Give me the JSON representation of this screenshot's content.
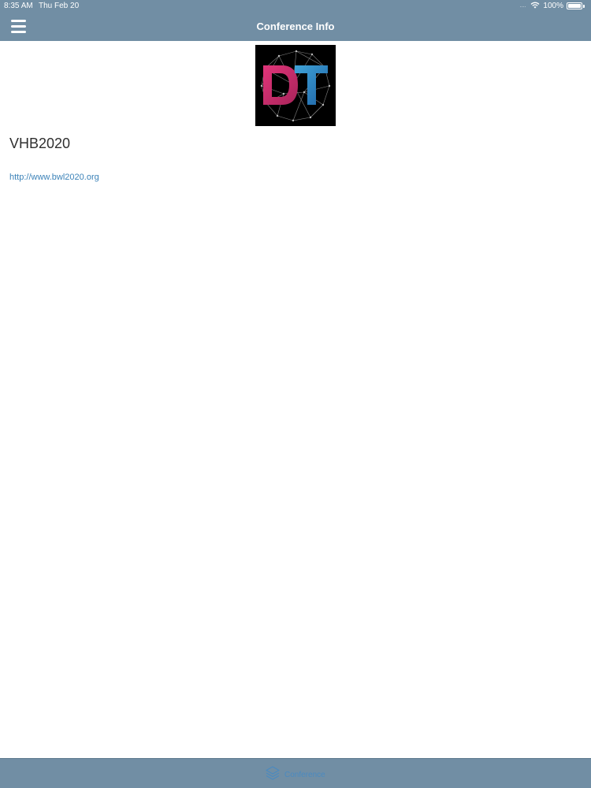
{
  "status_bar": {
    "time": "8:35 AM",
    "date": "Thu Feb 20",
    "signal": "....",
    "wifi_icon": "wifi-icon",
    "battery_text": "100%",
    "battery_level": 1.0
  },
  "nav": {
    "title": "Conference Info",
    "menu_icon": "hamburger-menu-icon"
  },
  "conference": {
    "logo_text": "DT",
    "name": "VHB2020",
    "url": "http://www.bwl2020.org"
  },
  "tabbar": {
    "items": [
      {
        "label": "Conference",
        "icon": "layers-icon",
        "active": true
      }
    ]
  },
  "colors": {
    "header_bg": "#718ea4",
    "link": "#3b82b8",
    "logo_pink": "#d4306b",
    "logo_blue": "#2e7fc0"
  }
}
